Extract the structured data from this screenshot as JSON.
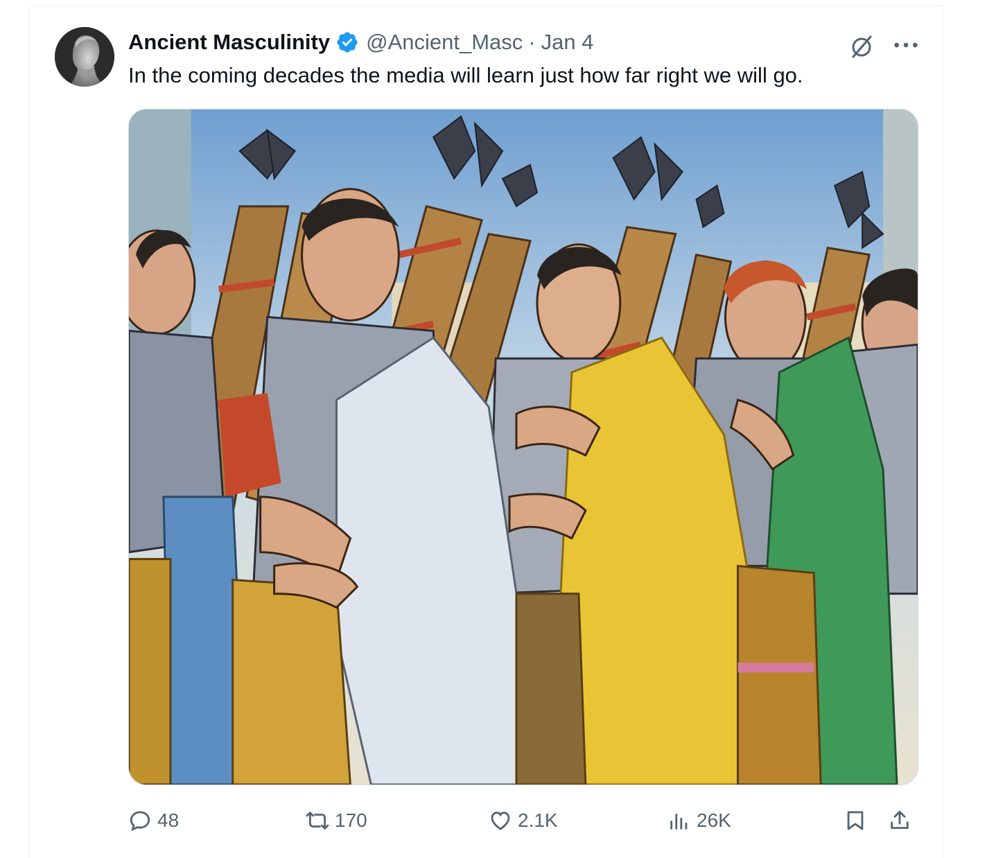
{
  "tweet": {
    "author_name": "Ancient Masculinity",
    "handle": "@Ancient_Masc",
    "separator": "·",
    "date": "Jan 4",
    "text": "In the coming decades the media will learn just how far right we will go.",
    "verified_color": "#1d9bf0"
  },
  "metrics": {
    "replies": "48",
    "reposts": "170",
    "likes": "2.1K",
    "views": "26K"
  },
  "icons": {
    "reply": "reply-icon",
    "repost": "repost-icon",
    "like": "heart-icon",
    "views": "views-icon",
    "bookmark": "bookmark-icon",
    "share": "share-icon",
    "grok": "grok-icon",
    "more": "more-icon"
  }
}
